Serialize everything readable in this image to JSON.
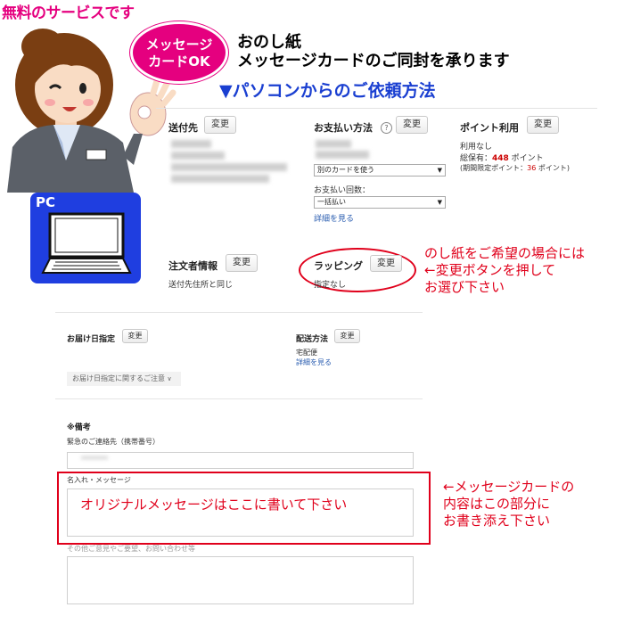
{
  "banner": {
    "free_label": "無料のサービスです",
    "bubble_line1": "メッセージ",
    "bubble_line2": "カードOK",
    "title_line1": "おのし紙",
    "title_line2": "メッセージカードのご同封を承ります",
    "subtitle": "▼パソコンからのご依頼方法",
    "pc_label": "PC"
  },
  "checkout": {
    "change_label": "変更",
    "shipping": {
      "heading": "送付先"
    },
    "payment": {
      "heading": "お支払い方法",
      "help_icon": "?",
      "card_select": "別のカードを使う",
      "installment_label": "お支払い回数：",
      "installment_select": "一括払い",
      "details_link": "詳細を見る"
    },
    "points": {
      "heading": "ポイント利用",
      "usage": "利用なし",
      "holdings_prefix": "総保有：",
      "holdings_value": "448",
      "holdings_unit": " ポイント",
      "limited_prefix": "(期間限定ポイント：",
      "limited_value": "36",
      "limited_suffix": " ポイント)"
    },
    "orderer": {
      "heading": "注文者情報",
      "value": "送付先住所と同じ"
    },
    "wrapping": {
      "heading": "ラッピング",
      "value": "指定なし"
    },
    "delivery_date": {
      "heading": "お届け日指定",
      "notice": "お届け日指定に関するご注意"
    },
    "delivery_method": {
      "heading": "配送方法",
      "value": "宅配便",
      "details_link": "詳細を見る"
    },
    "remarks": {
      "heading": "※備考",
      "emergency_label": "緊急のご連絡先（携帯番号）",
      "message_label": "名入れ・メッセージ",
      "message_text": "オリジナルメッセージはここに書いて下さい",
      "other_label": "その他ご意見やご要望、お問い合わせ等"
    }
  },
  "annotations": {
    "wrapping_note": [
      "のし紙をご希望の場合には",
      "←変更ボタンを押して",
      "お選び下さい"
    ],
    "message_note": [
      "←メッセージカードの",
      "内容はこの部分に",
      "お書き添え下さい"
    ]
  },
  "colors": {
    "accent_red": "#e0001b",
    "bubble_pink": "#e5007f",
    "subtitle_blue": "#1a3fd1",
    "pc_blue": "#1f3ee0",
    "link_blue": "#2a5db0",
    "points_red": "#cc0000"
  }
}
